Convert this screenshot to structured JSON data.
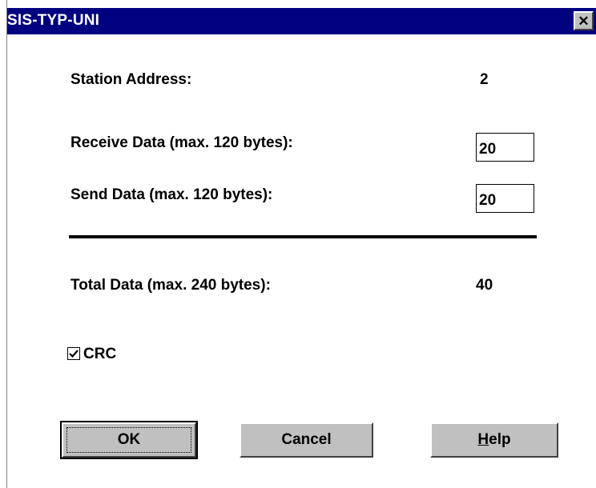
{
  "window": {
    "title": "SIS-TYP-UNI",
    "close_symbol": "✕"
  },
  "fields": {
    "station_address_label": "Station Address:",
    "station_address_value": "2",
    "receive_label": "Receive Data (max. 120 bytes):",
    "receive_value": "20",
    "send_label": "Send Data (max. 120 bytes):",
    "send_value": "20",
    "total_label": "Total Data (max. 240 bytes):",
    "total_value": "40"
  },
  "options": {
    "crc_label": "CRC",
    "crc_checked": true
  },
  "buttons": {
    "ok": "OK",
    "cancel": "Cancel",
    "help_first": "H",
    "help_rest": "elp"
  },
  "colors": {
    "titlebar": "#000080",
    "button_face": "#c0c0c0"
  }
}
